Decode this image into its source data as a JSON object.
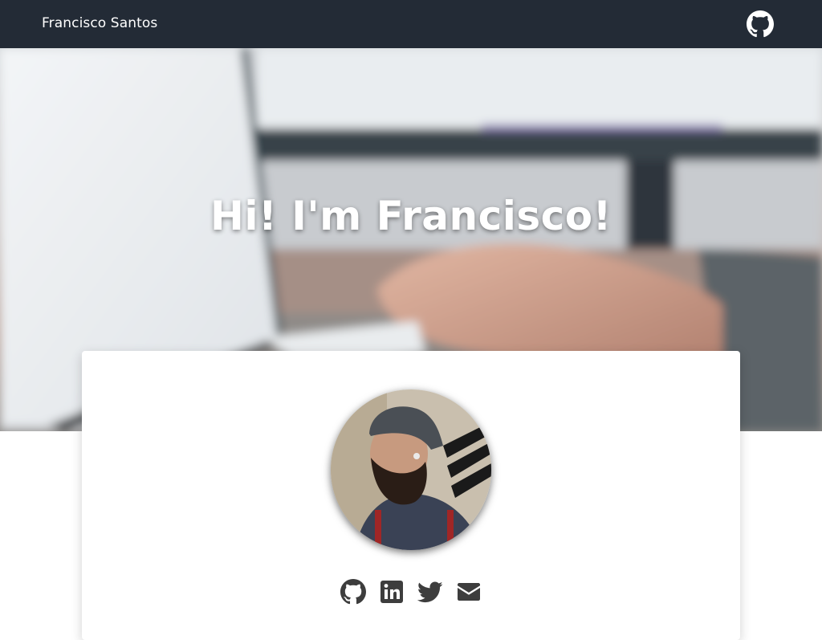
{
  "navbar": {
    "brand": "Francisco Santos",
    "github_icon": "github-icon"
  },
  "hero": {
    "title": "Hi! I'm Francisco!",
    "background": "photo of hands typing on a laptop in front of a monitor"
  },
  "profile": {
    "avatar": "portrait photo of a bearded man wearing a backwards cap and hoodie",
    "social_links": [
      {
        "icon": "github-icon"
      },
      {
        "icon": "linkedin-icon"
      },
      {
        "icon": "twitter-icon"
      },
      {
        "icon": "envelope-icon"
      }
    ]
  },
  "colors": {
    "navbar_bg": "#232b36",
    "text_light": "#ffffff",
    "icon_color": "#3d3d3d",
    "card_bg": "#ffffff"
  }
}
